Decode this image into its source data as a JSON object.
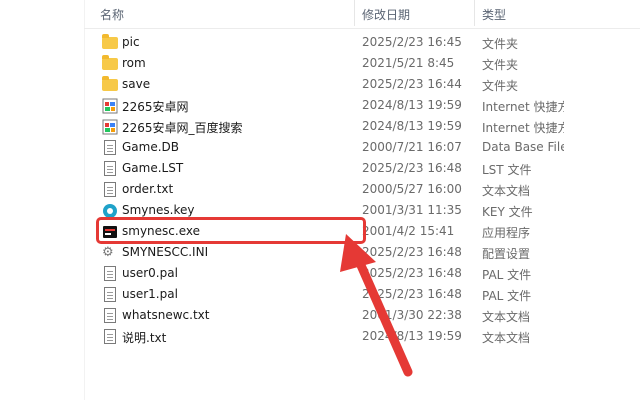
{
  "columns": {
    "name": "名称",
    "date": "修改日期",
    "type": "类型"
  },
  "files": [
    {
      "name": "pic",
      "date": "2025/2/23 16:45",
      "type": "文件夹",
      "icon": "folder-icon"
    },
    {
      "name": "rom",
      "date": "2021/5/21 8:45",
      "type": "文件夹",
      "icon": "folder-icon"
    },
    {
      "name": "save",
      "date": "2025/2/23 16:44",
      "type": "文件夹",
      "icon": "folder-icon"
    },
    {
      "name": "2265安卓网",
      "date": "2024/8/13 19:59",
      "type": "Internet 快捷方",
      "icon": "internet-shortcut-icon"
    },
    {
      "name": "2265安卓网_百度搜索",
      "date": "2024/8/13 19:59",
      "type": "Internet 快捷方",
      "icon": "internet-shortcut-icon"
    },
    {
      "name": "Game.DB",
      "date": "2000/7/21 16:07",
      "type": "Data Base File",
      "icon": "document-icon"
    },
    {
      "name": "Game.LST",
      "date": "2025/2/23 16:48",
      "type": "LST 文件",
      "icon": "document-icon"
    },
    {
      "name": "order.txt",
      "date": "2000/5/27 16:00",
      "type": "文本文档",
      "icon": "text-file-icon"
    },
    {
      "name": "Smynes.key",
      "date": "2001/3/31 11:35",
      "type": "KEY 文件",
      "icon": "key-file-icon"
    },
    {
      "name": "smynesc.exe",
      "date": "2001/4/2 15:41",
      "type": "应用程序",
      "icon": "exe-icon"
    },
    {
      "name": "SMYNESCC.INI",
      "date": "2025/2/23 16:48",
      "type": "配置设置",
      "icon": "gear-file-icon"
    },
    {
      "name": "user0.pal",
      "date": "2025/2/23 16:48",
      "type": "PAL 文件",
      "icon": "document-icon"
    },
    {
      "name": "user1.pal",
      "date": "2025/2/23 16:48",
      "type": "PAL 文件",
      "icon": "document-icon"
    },
    {
      "name": "whatsnewc.txt",
      "date": "2001/3/30 22:38",
      "type": "文本文档",
      "icon": "text-file-icon"
    },
    {
      "name": "说明.txt",
      "date": "2024/8/13 19:59",
      "type": "文本文档",
      "icon": "text-file-icon"
    }
  ],
  "highlighted_file": "smynesc.exe",
  "colors": {
    "annotation_red": "#e53935",
    "folder": "#f7c948"
  }
}
